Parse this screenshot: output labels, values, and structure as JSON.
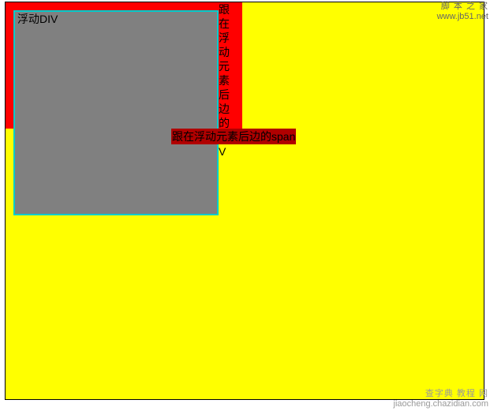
{
  "float_div_label": "浮动DIV",
  "following_div_text": "跟在浮动元素后边的DIV",
  "following_span_text": "跟在浮动元素后边的span",
  "watermark_top_name": "脚 本 之 家",
  "watermark_top_url": "www.jb51.net",
  "watermark_bottom_name": "查字典 教程 网",
  "watermark_bottom_url": "jiaocheng.chazidian.com"
}
